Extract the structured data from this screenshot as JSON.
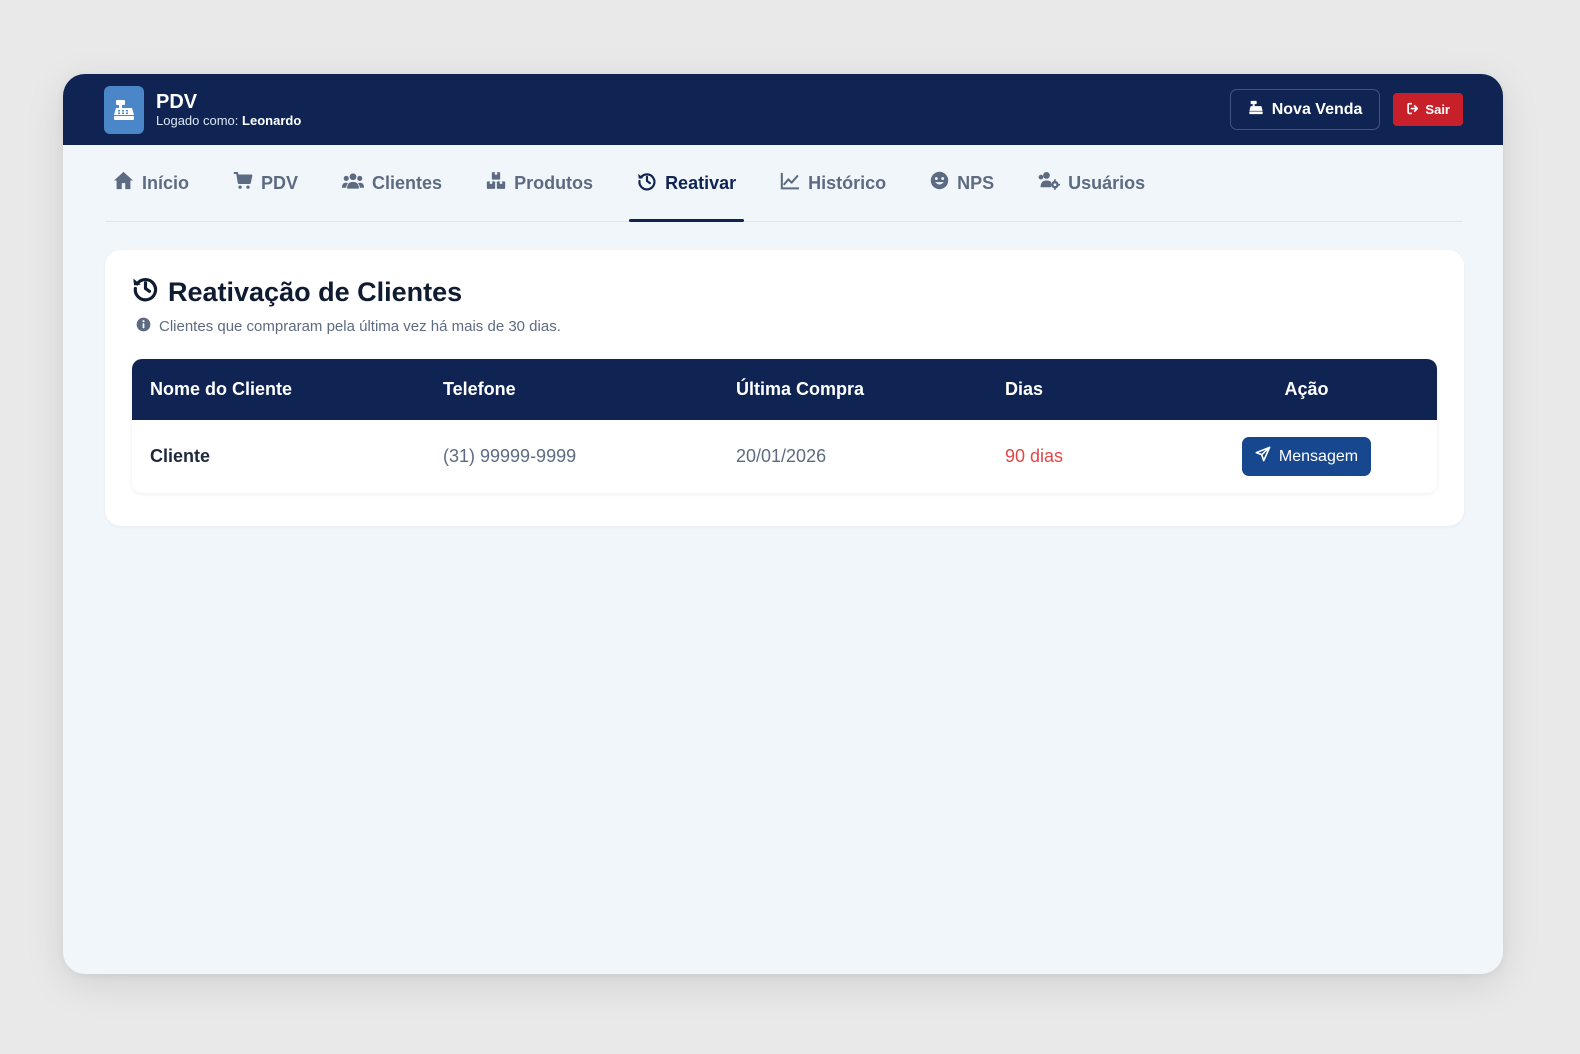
{
  "header": {
    "brand_title": "PDV",
    "logged_as_label": "Logado como:",
    "user_name": "Leonardo",
    "new_sale_label": "Nova Venda",
    "logout_label": "Sair"
  },
  "nav": {
    "tabs": [
      {
        "label": "Início",
        "icon": "home-icon",
        "active": false
      },
      {
        "label": "PDV",
        "icon": "cart-icon",
        "active": false
      },
      {
        "label": "Clientes",
        "icon": "users-icon",
        "active": false
      },
      {
        "label": "Produtos",
        "icon": "boxes-icon",
        "active": false
      },
      {
        "label": "Reativar",
        "icon": "history-icon",
        "active": true
      },
      {
        "label": "Histórico",
        "icon": "chart-line-icon",
        "active": false
      },
      {
        "label": "NPS",
        "icon": "smile-icon",
        "active": false
      },
      {
        "label": "Usuários",
        "icon": "users-cog-icon",
        "active": false
      }
    ]
  },
  "main": {
    "title": "Reativação de Clientes",
    "subtitle": "Clientes que compraram pela última vez há mais de 30 dias.",
    "table": {
      "columns": [
        "Nome do Cliente",
        "Telefone",
        "Última Compra",
        "Dias",
        "Ação"
      ],
      "rows": [
        {
          "name": "Cliente",
          "phone": "(31) 99999-9999",
          "last_purchase": "20/01/2026",
          "days": "90 dias",
          "action_label": "Mensagem"
        }
      ]
    }
  },
  "colors": {
    "primary": "#0f2452",
    "accent": "#17478f",
    "danger": "#c8202a",
    "days_highlight": "#e04848",
    "background": "#f1f6fa"
  }
}
